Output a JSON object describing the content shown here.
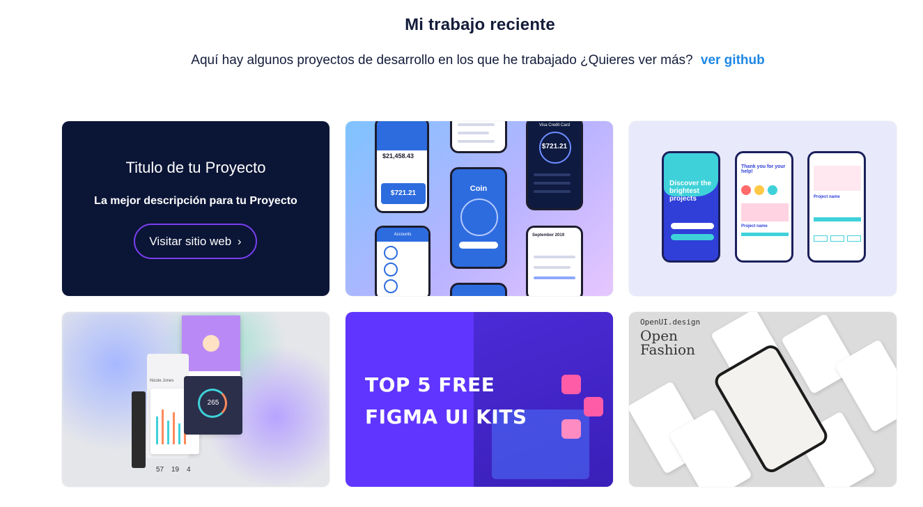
{
  "header": {
    "title": "Mi trabajo reciente",
    "subtitle": "Aquí hay algunos proyectos de desarrollo en los que he trabajado ¿Quieres ver más?",
    "github_link": "ver github"
  },
  "project_card": {
    "title": "Titulo de tu Proyecto",
    "description": "La mejor descripción para tu Proyecto",
    "button": "Visitar sitio web",
    "button_icon": "chevron-right-icon"
  },
  "thumbnails": {
    "wallet": {
      "balance": "$21,458.43",
      "card_amount": "$721.21",
      "coin_label": "Coin",
      "visa_title": "Visa Credit Card",
      "visa_amount": "$721.21",
      "month": "September 2019",
      "accounts": "Accounts"
    },
    "onboarding": {
      "headline": "Discover the brightest projects",
      "thanks": "Thank you for your help!",
      "project": "Project name"
    },
    "dashboard": {
      "profile": "Nicole Jones",
      "gauge": "265",
      "stat1": "57",
      "stat2": "19",
      "stat3": "4"
    },
    "figma": {
      "line1": "TOP 5 FREE",
      "line2": "FIGMA UI KITS"
    },
    "fashion": {
      "brand": "OpenUI.design",
      "title_line1": "Open",
      "title_line2": "Fashion"
    }
  },
  "colors": {
    "text": "#141c3a",
    "link": "#1e88e5",
    "card_dark": "#0b1536",
    "button_border": "#7b3ff2",
    "figma_bg": "#5f35ff"
  }
}
